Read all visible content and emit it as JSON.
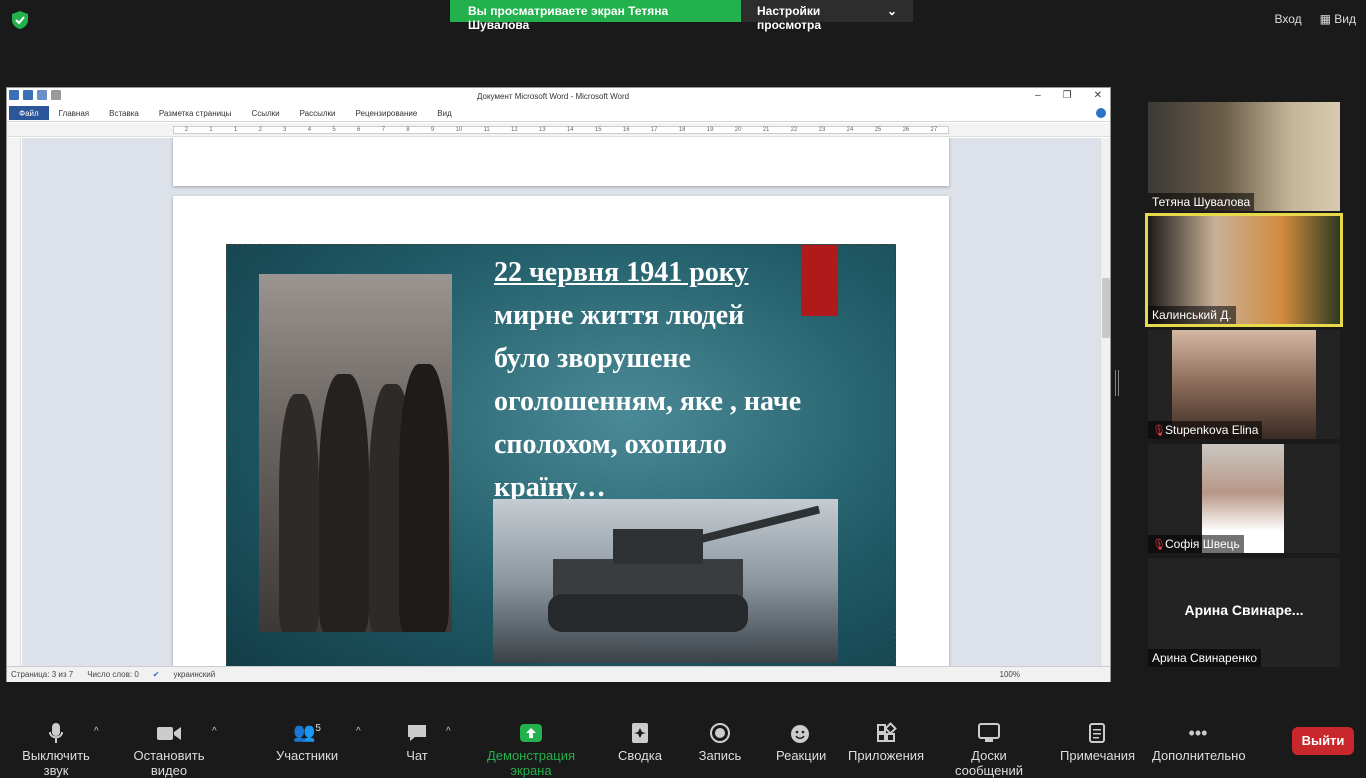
{
  "topbar": {
    "banner_text": "Вы просматриваете экран Тетяна Шувалова",
    "view_options": "Настройки просмотра",
    "signin": "Вход",
    "view": "Вид"
  },
  "word": {
    "title": "Документ Microsoft Word  -  Microsoft Word",
    "tabs": [
      "Файл",
      "Главная",
      "Вставка",
      "Разметка страницы",
      "Ссылки",
      "Рассылки",
      "Рецензирование",
      "Вид"
    ],
    "ruler_marks": [
      "2",
      "1",
      "1",
      "2",
      "3",
      "4",
      "5",
      "6",
      "7",
      "8",
      "9",
      "10",
      "11",
      "12",
      "13",
      "14",
      "15",
      "16",
      "17",
      "18",
      "19",
      "20",
      "21",
      "22",
      "23",
      "24",
      "25",
      "26",
      "27"
    ],
    "status": {
      "page": "Страница: 3 из 7",
      "words": "Число слов: 0",
      "lang": "украинский",
      "zoom": "100%"
    },
    "slide": {
      "heading": "22 червня 1941 року",
      "lines": [
        "мирне життя людей",
        "було зворушене",
        "оголошенням, яке , наче",
        "сполохом, охопило",
        "країну…"
      ]
    }
  },
  "participants": [
    {
      "name": "Тетяна Шувалова",
      "muted": false
    },
    {
      "name": "Калинський Д.",
      "muted": false
    },
    {
      "name": "Stupenkova Elina",
      "muted": true
    },
    {
      "name": "Софія Швець",
      "muted": true
    },
    {
      "name": "Арина Свинаренко",
      "display": "Арина  Свинаре...",
      "muted": false
    }
  ],
  "toolbar": {
    "mute": "Выключить звук",
    "video": "Остановить видео",
    "participants": "Участники",
    "participants_count": "5",
    "chat": "Чат",
    "share": "Демонстрация экрана",
    "summary": "Сводка",
    "record": "Запись",
    "reactions": "Реакции",
    "apps": "Приложения",
    "whiteboards": "Доски сообщений",
    "notes": "Примечания",
    "more": "Дополнительно",
    "leave": "Выйти"
  },
  "colors": {
    "share_green": "#23b14d",
    "leave_red": "#c8282b",
    "active_speaker": "#e8d94a",
    "word_blue": "#2b579a"
  }
}
